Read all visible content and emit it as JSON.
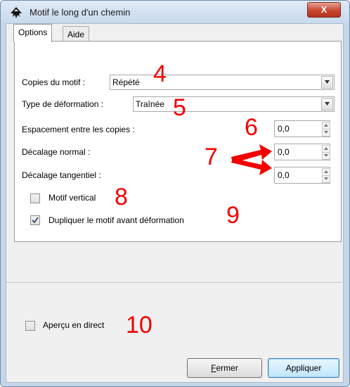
{
  "window": {
    "title": "Motif le long d'un chemin",
    "close_glyph": "X"
  },
  "tabs": [
    {
      "label": "Options"
    },
    {
      "label": "Aide"
    }
  ],
  "form": {
    "copies_label": "Copies du motif :",
    "copies_value": "Répété",
    "deformation_label": "Type de déformation :",
    "deformation_value": "Traînée",
    "spacing_label": "Espacement entre les copies :",
    "spacing_value": "0,0",
    "normal_offset_label": "Décalage normal :",
    "normal_offset_value": "0,0",
    "tangential_offset_label": "Décalage tangentiel :",
    "tangential_offset_value": "0,0",
    "vertical_label": "Motif vertical",
    "vertical_checked": false,
    "duplicate_label": "Dupliquer le motif avant déformation",
    "duplicate_checked": true
  },
  "preview": {
    "label": "Aperçu en direct",
    "checked": false
  },
  "buttons": {
    "close_first": "F",
    "close_rest": "ermer",
    "apply": "Appliquer"
  },
  "annotations": {
    "n4": "4",
    "n5": "5",
    "n6": "6",
    "n7": "7",
    "n8": "8",
    "n9": "9",
    "n10": "10",
    "color": "#f20000"
  },
  "colors": {
    "titlebar": "#c7d9ec",
    "close_button": "#c9452f",
    "panel_background": "#f0f0f0"
  },
  "icons": [
    "inkscape-icon",
    "close-icon",
    "dropdown-arrow-icon",
    "spin-up-icon",
    "spin-down-icon",
    "check-icon",
    "red-arrow-icon"
  ]
}
